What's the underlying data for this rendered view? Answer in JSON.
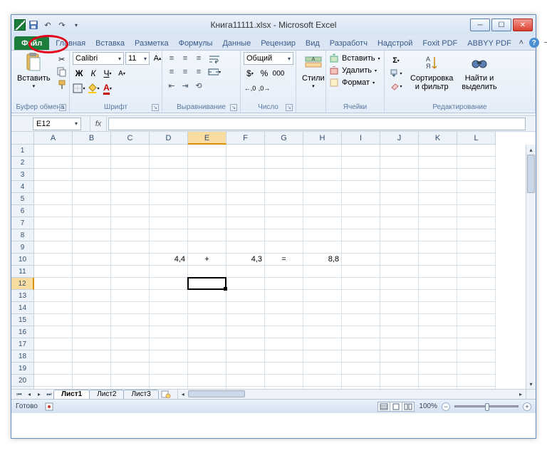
{
  "title": "Книга11111.xlsx - Microsoft Excel",
  "qat": {
    "save": "💾",
    "undo": "↶",
    "redo": "↷"
  },
  "tabs": {
    "file": "Файл",
    "items": [
      "Главная",
      "Вставка",
      "Разметка",
      "Формулы",
      "Данные",
      "Рецензир",
      "Вид",
      "Разработч",
      "Надстрой",
      "Foxit PDF",
      "ABBYY PDF"
    ]
  },
  "ribbon": {
    "clipboard": {
      "paste": "Вставить",
      "label": "Буфер обмена"
    },
    "font": {
      "name": "Calibri",
      "size": "11",
      "label": "Шрифт"
    },
    "align": {
      "label": "Выравнивание"
    },
    "number": {
      "format": "Общий",
      "label": "Число"
    },
    "styles": {
      "btn": "Стили",
      "label": ""
    },
    "cells": {
      "insert": "Вставить",
      "delete": "Удалить",
      "format": "Формат",
      "label": "Ячейки"
    },
    "editing": {
      "sort": "Сортировка\nи фильтр",
      "find": "Найти и\nвыделить",
      "label": "Редактирование"
    }
  },
  "namebox": "E12",
  "fx": "fx",
  "columns": [
    "A",
    "B",
    "C",
    "D",
    "E",
    "F",
    "G",
    "H",
    "I",
    "J",
    "K",
    "L"
  ],
  "row_count": 22,
  "selected_col": "E",
  "selected_row": 12,
  "cells": {
    "r10": {
      "D": "4,4",
      "E": "+",
      "F": "4,3",
      "G": "=",
      "H": "8,8"
    }
  },
  "sheets": {
    "active": "Лист1",
    "others": [
      "Лист2",
      "Лист3"
    ]
  },
  "status": {
    "ready": "Готово",
    "zoom": "100%"
  }
}
